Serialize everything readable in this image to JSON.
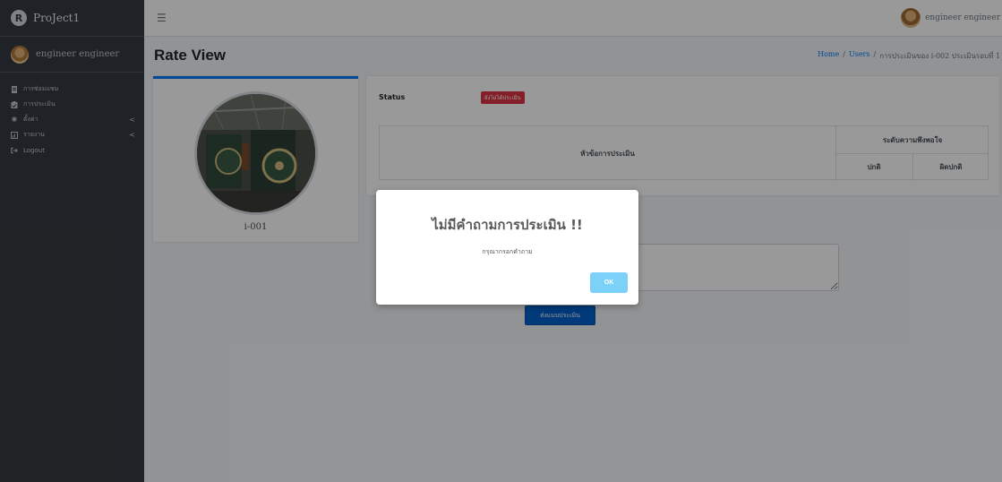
{
  "app": {
    "brand": "ProJect1"
  },
  "sidebar": {
    "user_name": "engineer engineer",
    "items": [
      {
        "label": "การซ่อมแซม",
        "icon": "document-icon"
      },
      {
        "label": "การประเมิน",
        "icon": "clipboard-icon"
      },
      {
        "label": "ตั้งค่า",
        "icon": "gear-icon",
        "chevron": "<"
      },
      {
        "label": "รายงาน",
        "icon": "report-icon",
        "chevron": "<"
      },
      {
        "label": "Logout",
        "icon": "logout-icon"
      }
    ]
  },
  "topbar": {
    "user_name": "engineer engineer"
  },
  "header": {
    "title": "Rate View",
    "breadcrumb": [
      "Home",
      "/",
      "Users",
      "/",
      "การประเมินของ i-002 ประเมินรอบที่ 1"
    ]
  },
  "profile": {
    "name": "i-001"
  },
  "evaluation": {
    "status_label": "Status",
    "status_badge": "ยังไม่ได้ประเมิน",
    "table": {
      "topic_header": "หัวข้อการประเมิน",
      "satisfaction_header": "ระดับความพึงพอใจ",
      "normal_header": "ปกติ",
      "abnormal_header": "ผิดปกติ"
    },
    "submit_label": "ส่งแบบประเมิน"
  },
  "modal": {
    "title": "ไม่มีคำถามการประเมิน !!",
    "text": "กรุณากรอกคำถาม",
    "ok_label": "OK"
  },
  "colors": {
    "sidebar_bg": "#343a40",
    "accent": "#007bff",
    "danger": "#dc3545",
    "modal_ok": "#7cd1f9"
  }
}
